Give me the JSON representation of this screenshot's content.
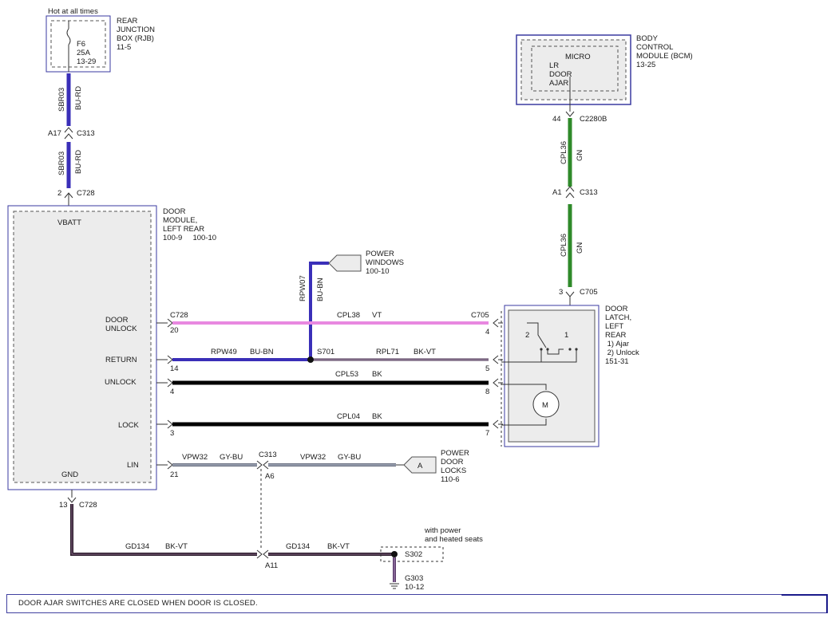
{
  "colors": {
    "blue": "#3a2fb8",
    "green": "#2f8a2a",
    "pink": "#e888e0",
    "black": "#000000",
    "gray": "#6a7080",
    "purple": "#5a3a6a",
    "frame": "#3a3aa0",
    "module_fill": "#e8e8e8"
  },
  "rjb": {
    "hot_label": "Hot at all times",
    "name": [
      "REAR",
      "JUNCTION",
      "BOX (RJB)",
      "11-5"
    ],
    "fuse": [
      "F6",
      "25A",
      "13-29"
    ]
  },
  "wire_sbr03": {
    "circuit": "SBR03",
    "color": "BU-RD",
    "pin_upper": "A17",
    "conn_upper": "C313",
    "pin_lower": "2",
    "conn_lower": "C728"
  },
  "door_module": {
    "name": [
      "DOOR",
      "MODULE,",
      "LEFT REAR",
      "100-9     100-10"
    ],
    "vbatt": "VBATT",
    "gnd": "GND",
    "pins": [
      {
        "name": [
          "DOOR",
          "UNLOCK"
        ],
        "pin": "20"
      },
      {
        "name": [
          "RETURN"
        ],
        "pin": "14"
      },
      {
        "name": [
          "UNLOCK"
        ],
        "pin": "4"
      },
      {
        "name": [
          "LOCK"
        ],
        "pin": "3"
      },
      {
        "name": [
          "LIN"
        ],
        "pin": "21"
      }
    ],
    "conn": "C728"
  },
  "bcm": {
    "name": [
      "BODY",
      "CONTROL",
      "MODULE (BCM)",
      "13-25"
    ],
    "inner": [
      "MICRO",
      "LR",
      "DOOR",
      "AJAR"
    ]
  },
  "wire_cpl36": {
    "circuit": "CPL36",
    "color": "GN",
    "pin_top": "44",
    "conn_top": "C2280B",
    "pin_mid": "A1",
    "conn_mid": "C313",
    "pin_bottom": "3",
    "conn_bottom": "C705"
  },
  "power_windows": {
    "name": [
      "POWER",
      "WINDOWS",
      "100-10"
    ],
    "circuit": "RPW07",
    "color": "BU-BN"
  },
  "wires": {
    "cpl38": {
      "conn_left": "C728",
      "circuit": "CPL38",
      "color": "VT",
      "conn_right": "C705",
      "pin_right": "4"
    },
    "return_left": {
      "circuit": "RPW49",
      "color": "BU-BN",
      "splice": "S701"
    },
    "return_right": {
      "circuit": "RPL71",
      "color": "BK-VT",
      "pin_right": "5"
    },
    "cpl53": {
      "circuit": "CPL53",
      "color": "BK",
      "pin_right": "8"
    },
    "cpl04": {
      "circuit": "CPL04",
      "color": "BK",
      "pin_right": "7"
    },
    "lin_left": {
      "circuit": "VPW32",
      "color": "GY-BU"
    },
    "lin_right": {
      "circuit": "VPW32",
      "color": "GY-BU"
    },
    "lin_conn": "C313",
    "lin_pin": "A6"
  },
  "power_door_locks": {
    "tag": "A",
    "name": [
      "POWER",
      "DOOR",
      "LOCKS",
      "110-6"
    ]
  },
  "door_latch": {
    "name": [
      "DOOR",
      "LATCH,",
      "LEFT",
      "REAR",
      " 1) Ajar",
      " 2) Unlock",
      "151-31"
    ],
    "switch_2": "2",
    "switch_1": "1",
    "motor": "M"
  },
  "ground": {
    "pin": "13",
    "conn": "C728",
    "wire1_circuit": "GD134",
    "wire1_color": "BK-VT",
    "wire2_circuit": "GD134",
    "wire2_color": "BK-VT",
    "pin_a11": "A11",
    "splice": "S302",
    "option_note": [
      "with power",
      "and heated seats"
    ],
    "ground_id": "G303",
    "ground_page": "10-12"
  },
  "note": "DOOR AJAR SWITCHES ARE CLOSED WHEN DOOR IS CLOSED."
}
